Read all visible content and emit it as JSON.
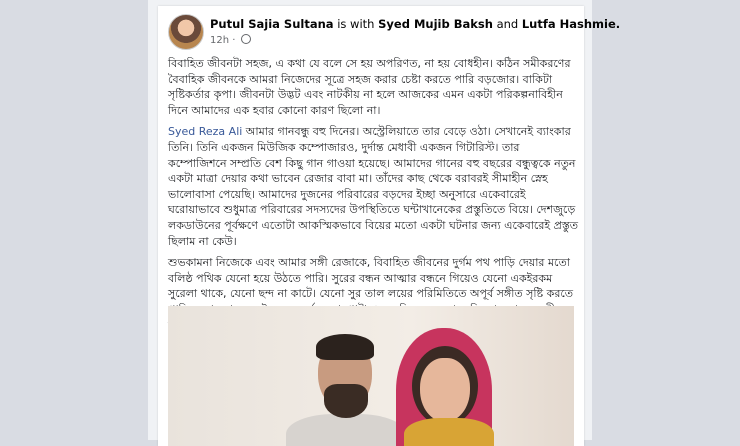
{
  "post": {
    "author": "Putul Sajia Sultana",
    "with_text": "is with",
    "tag1": "Syed Mujib Baksh",
    "and_text": "and",
    "tag2": "Lutfa Hashmie.",
    "time": "12h",
    "paragraph1": "বিবাহিত জীবনটা সহজ, এ কথা যে বলে সে হয় অপরিণত, না হয়  বোধহীন। কঠিন সমীকরণের বৈবাহিক জীবনকে আমরা নিজেদের সূত্রে সহজ করার চেষ্টা করতে পারি বড়জোর। বাকিটা সৃষ্টিকর্তার কৃপা। জীবনটা উদ্ভট এবং নাটকীয় না হলে আজকের এমন একটা পরিকল্পনাবিহীন দিনে আমাদের এক হবার কোনো কারণ ছিলো না।",
    "mention": "Syed Reza Ali",
    "paragraph2": " আমার গানবন্ধু বহু দিনের। অস্ট্রেলিয়াতে তার বেড়ে ওঠা। সেখানেই ব্যাংকার তিনি। তিনি একজন মিউজিক কম্পোজারও, দুর্দান্ত মেধাবী একজন গিটারিস্ট। তার কম্পোজিশনে সম্প্রতি বেশ কিছু গান গাওয়া হয়েছে। আমাদের গানের বহু বছরের বন্ধুত্বকে নতুন একটা মাত্রা দেয়ার কথা ভাবেন রেজার বাবা মা। তাঁদের কাছ থেকে বরাবরই সীমাহীন স্নেহ ভালোবাসা পেয়েছি। আমাদের দুজনের পরিবারের বড়দের ইচ্ছা অনুসারে একেবারেই ঘরোয়াভাবে শুধুমাত্র পরিবারের সদস্যদের উপস্থিতিতে ঘন্টাখানেকের প্রস্তুতিতে বিয়ে। দেশজুড়ে লকডাউনের পূর্বক্ষণে এতোটা আকস্মিকভাবে বিয়ের মতো একটা ঘটনার জন্য একেবারেই প্রস্তুত ছিলাম না কেউ।",
    "paragraph3": "শুভকামনা নিজেকে এবং আমার সঙ্গী রেজাকে, বিবাহিত জীবনের দুর্গম পথ পাড়ি দেয়ার মতো বলিষ্ঠ পথিক যেনো হয়ে উঠতে পারি। সুরের বন্ধন আত্মার বন্ধনে গিয়েও যেনো একইরকম সুরেলা থাকে, যেনো ছন্দ না কাটে। যেনো সুর তাল লয়ের পরিমিতিতে অপূর্ব সঙ্গীত সৃষ্টি করতে পারি সংসার নামের এই রহস্য-দুর্ভেদ্য জায়গাটায়। বন্ধু হিসেবে যেভাবে চিনতাম তাকে, সঙ্গী হিসেবেও সেই চেনাটাই যেনো সত্যি হয় 😊"
  }
}
